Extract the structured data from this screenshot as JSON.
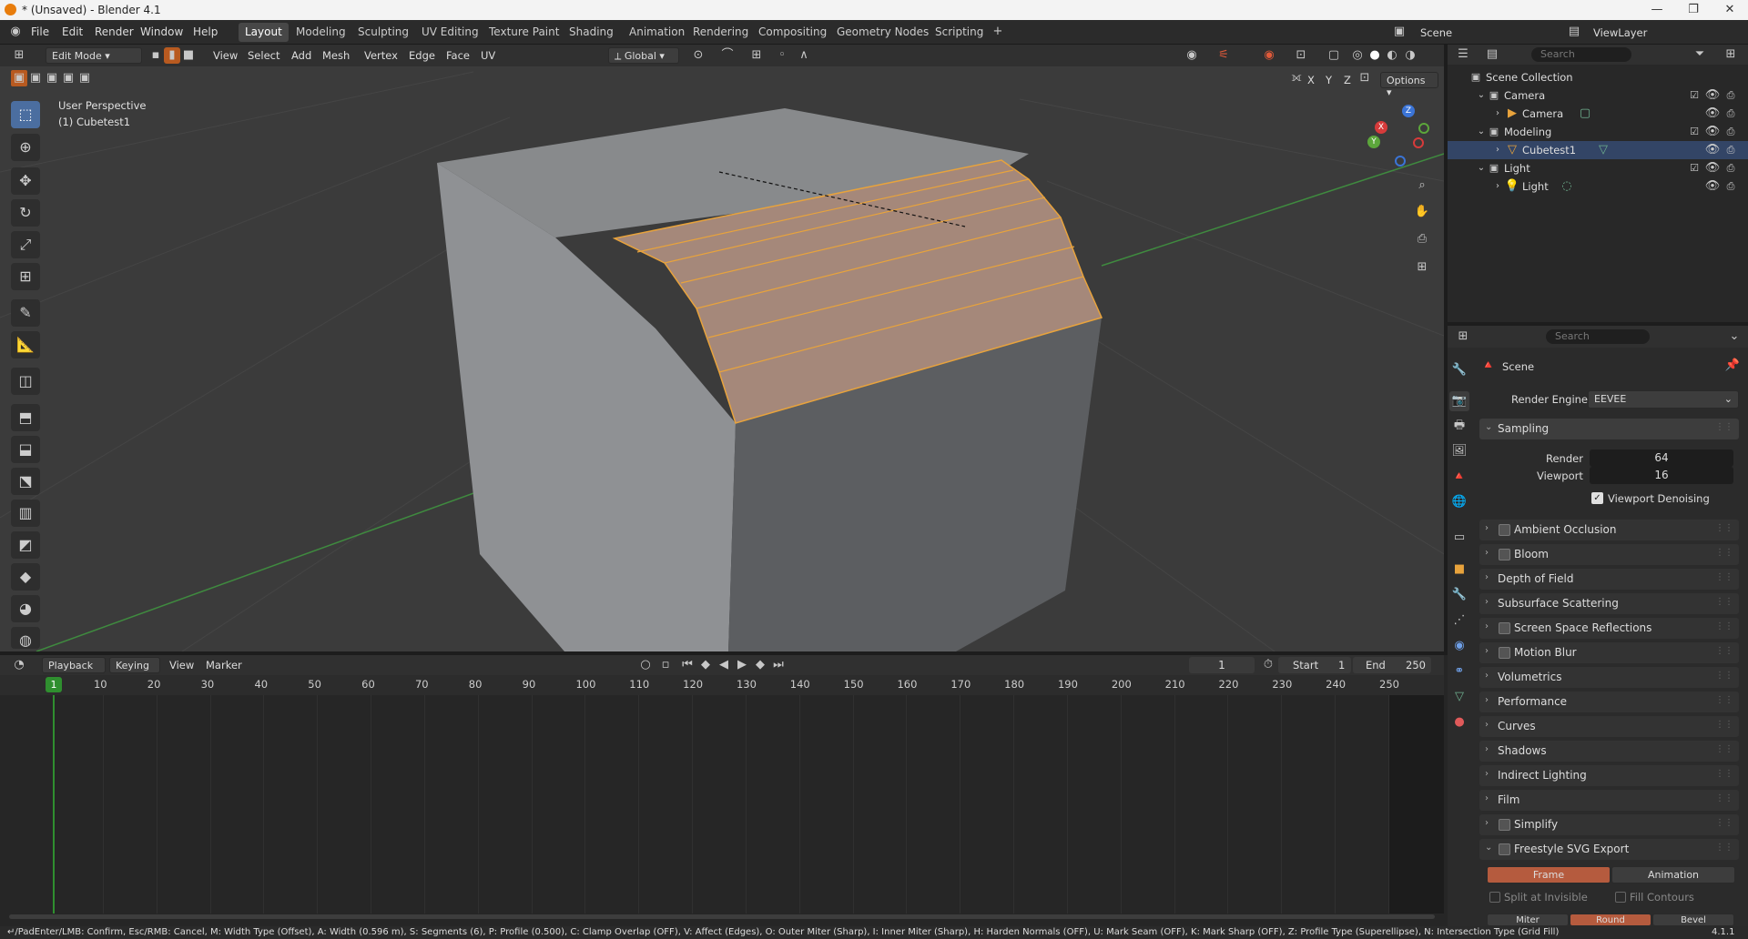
{
  "window": {
    "title": "* (Unsaved) - Blender 4.1"
  },
  "menu": [
    "File",
    "Edit",
    "Render",
    "Window",
    "Help"
  ],
  "workspaces": [
    "Layout",
    "Modeling",
    "Sculpting",
    "UV Editing",
    "Texture Paint",
    "Shading",
    "Animation",
    "Rendering",
    "Compositing",
    "Geometry Nodes",
    "Scripting"
  ],
  "active_workspace": "Layout",
  "scene_selector": {
    "label": "Scene",
    "view_layer": "ViewLayer"
  },
  "viewport_header": {
    "mode": "Edit Mode",
    "menus": [
      "View",
      "Select",
      "Add",
      "Mesh",
      "Vertex",
      "Edge",
      "Face",
      "UV"
    ],
    "orientation": "Global",
    "axes": [
      "X",
      "Y",
      "Z"
    ],
    "options": "Options"
  },
  "viewport": {
    "view_name": "User Perspective",
    "object_name": "(1) Cubetest1",
    "gizmo_labels": [
      "Z",
      "X",
      "Y"
    ]
  },
  "outliner": {
    "search_placeholder": "Search",
    "root": "Scene Collection",
    "rows": [
      {
        "label": "Camera",
        "kind": "collection"
      },
      {
        "label": "Camera",
        "kind": "object"
      },
      {
        "label": "Modeling",
        "kind": "collection"
      },
      {
        "label": "Cubetest1",
        "kind": "object"
      },
      {
        "label": "Light",
        "kind": "collection"
      },
      {
        "label": "Light",
        "kind": "object"
      }
    ]
  },
  "properties": {
    "search_placeholder": "Search",
    "context": "Scene",
    "render_engine_label": "Render Engine",
    "render_engine": "EEVEE",
    "sampling": {
      "title": "Sampling",
      "render_label": "Render",
      "render": "64",
      "viewport_label": "Viewport",
      "viewport": "16",
      "denoise_label": "Viewport Denoising"
    },
    "panels": [
      {
        "label": "Ambient Occlusion",
        "checkbox": true
      },
      {
        "label": "Bloom",
        "checkbox": true
      },
      {
        "label": "Depth of Field",
        "checkbox": false
      },
      {
        "label": "Subsurface Scattering",
        "checkbox": false
      },
      {
        "label": "Screen Space Reflections",
        "checkbox": true
      },
      {
        "label": "Motion Blur",
        "checkbox": true
      },
      {
        "label": "Volumetrics",
        "checkbox": false
      },
      {
        "label": "Performance",
        "checkbox": false
      },
      {
        "label": "Curves",
        "checkbox": false
      },
      {
        "label": "Shadows",
        "checkbox": false
      },
      {
        "label": "Indirect Lighting",
        "checkbox": false
      },
      {
        "label": "Film",
        "checkbox": false
      },
      {
        "label": "Simplify",
        "checkbox": true
      },
      {
        "label": "Freestyle SVG Export",
        "checkbox": true
      }
    ],
    "freestyle": {
      "frame": "Frame",
      "animation": "Animation",
      "split": "Split at Invisible",
      "fill": "Fill Contours",
      "miter": "Miter",
      "round": "Round",
      "bevel": "Bevel"
    }
  },
  "timeline": {
    "menus": [
      "Playback",
      "Keying",
      "View",
      "Marker"
    ],
    "current_frame": "1",
    "start_label": "Start",
    "start": "1",
    "end_label": "End",
    "end": "250",
    "ticks": [
      "1",
      "10",
      "20",
      "30",
      "40",
      "50",
      "60",
      "70",
      "80",
      "90",
      "100",
      "110",
      "120",
      "130",
      "140",
      "150",
      "160",
      "170",
      "180",
      "190",
      "200",
      "210",
      "220",
      "230",
      "240",
      "250"
    ]
  },
  "status": {
    "text": "↵/PadEnter/LMB: Confirm, Esc/RMB: Cancel, M: Width Type (Offset), A: Width (0.596 m), S: Segments (6), P: Profile (0.500), C: Clamp Overlap (OFF), V: Affect (Edges), O: Outer Miter (Sharp), I: Inner Miter (Sharp), H: Harden Normals (OFF), U: Mark Seam (OFF), K: Mark Sharp (OFF), Z: Profile Type (Superellipse), N: Intersection Type (Grid Fill)",
    "version": "4.1.1"
  },
  "colors": {
    "accent": "#e8a33c",
    "selected_face": "#a5887a",
    "active_tab": "#4b6ea0",
    "frame_marker": "#2f8f2f"
  }
}
